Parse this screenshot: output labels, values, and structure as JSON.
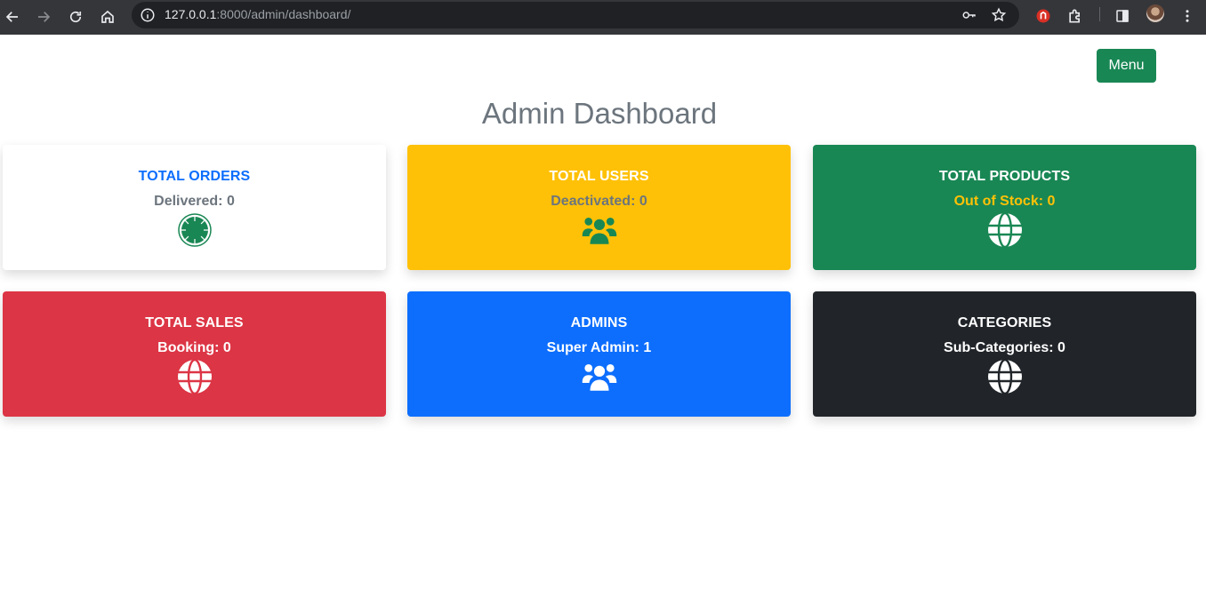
{
  "browser": {
    "url_host": "127.0.0.1",
    "url_path": ":8000/admin/dashboard/"
  },
  "header": {
    "menu_label": "Menu",
    "title": "Admin Dashboard"
  },
  "cards": [
    {
      "title": "TOTAL ORDERS",
      "subtitle": "Delivered: 0",
      "icon": "spinner-icon",
      "bg": "#ffffff",
      "title_color": "#0d6efd",
      "sub_color": "#6c757d",
      "icon_color": "#198754"
    },
    {
      "title": "TOTAL USERS",
      "subtitle": "Deactivated: 0",
      "icon": "users-icon",
      "bg": "#ffc107",
      "title_color": "#ffffff",
      "sub_color": "#6c757d",
      "icon_color": "#198754"
    },
    {
      "title": "TOTAL PRODUCTS",
      "subtitle": "Out of Stock: 0",
      "icon": "globe-icon",
      "bg": "#198754",
      "title_color": "#ffffff",
      "sub_color": "#ffc107",
      "icon_color": "#ffffff"
    },
    {
      "title": "TOTAL SALES",
      "subtitle": "Booking: 0",
      "icon": "globe-icon",
      "bg": "#dc3545",
      "title_color": "#ffffff",
      "sub_color": "#ffffff",
      "icon_color": "#ffffff"
    },
    {
      "title": "ADMINS",
      "subtitle": "Super Admin: 1",
      "icon": "users-icon",
      "bg": "#0d6efd",
      "title_color": "#ffffff",
      "sub_color": "#ffffff",
      "icon_color": "#ffffff"
    },
    {
      "title": "CATEGORIES",
      "subtitle": "Sub-Categories: 0",
      "icon": "globe-icon",
      "bg": "#212529",
      "title_color": "#ffffff",
      "sub_color": "#ffffff",
      "icon_color": "#ffffff"
    }
  ]
}
